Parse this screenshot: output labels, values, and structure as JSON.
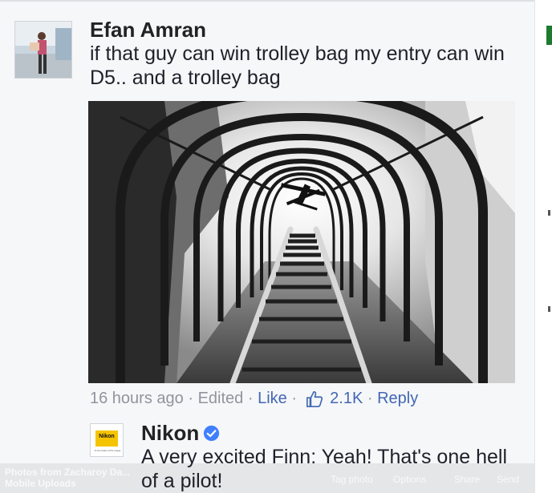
{
  "comment": {
    "author": "Efan Amran",
    "text": "if that guy can win trolley bag my entry can win D5.. and a trolley bag",
    "timestamp": "16 hours ago",
    "edited": "Edited",
    "like": "Like",
    "reaction_count": "2.1K",
    "reply": "Reply",
    "separator": "·"
  },
  "reply": {
    "author": "Nikon",
    "avatar_logo_text": "Nikon",
    "avatar_tagline": "At the heart of the image",
    "text": "A very excited Finn: Yeah! That's one hell of a pilot!"
  },
  "photo_viewer": {
    "album_info_line1": "Photos from Zacharoy Da...",
    "album_info_line2": "Mobile Uploads",
    "actions": [
      "Tag photo",
      "Options",
      "Share",
      "Send"
    ]
  },
  "colors": {
    "link_blue": "#4267b2",
    "meta_gray": "#90949c",
    "verified_blue": "#4080ff",
    "nikon_yellow": "#f5c400"
  }
}
